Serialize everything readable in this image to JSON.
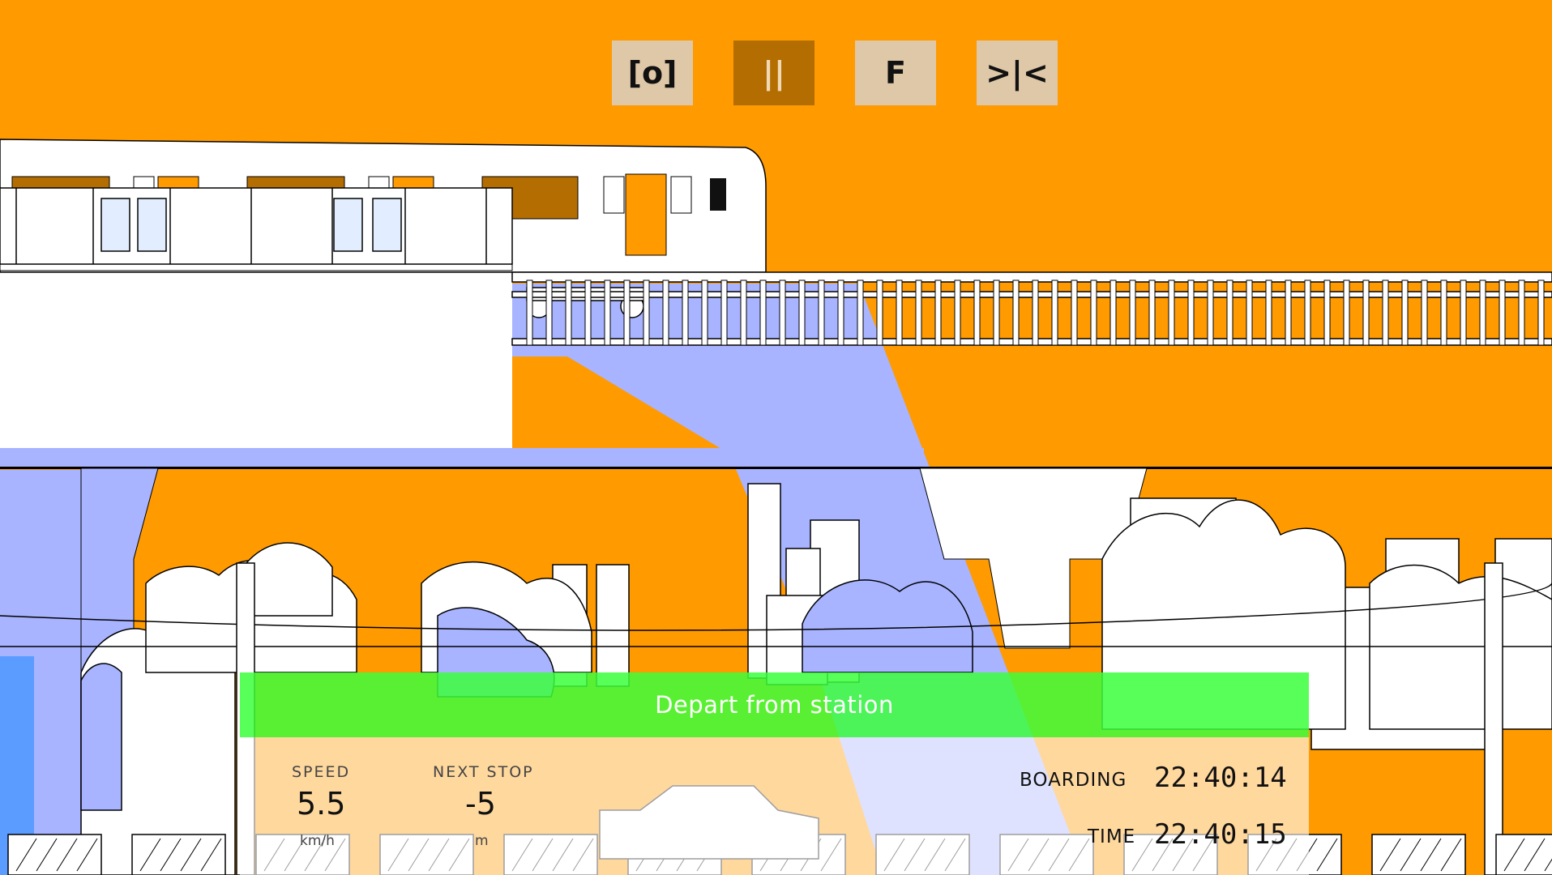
{
  "controls": {
    "camera_label": "[o]",
    "pause_label": "||",
    "forward_label": "F",
    "couple_label": ">|<"
  },
  "action": {
    "label": "Depart from station"
  },
  "hud": {
    "speed_label": "SPEED",
    "speed_value": "5.5",
    "speed_unit": "km/h",
    "next_stop_label": "NEXT STOP",
    "next_stop_value": "-5",
    "next_stop_unit": "m",
    "boarding_label": "BOARDING",
    "boarding_time": "22:40:14",
    "time_label": "TIME",
    "time_value": "22:40:15"
  },
  "colors": {
    "sky": "#ff9a00",
    "shadow": "#a8b4ff",
    "train_window": "#b36d00",
    "action_bar": "#3cff3c",
    "button_light": "#dfc8a8",
    "button_active": "#b36d00"
  }
}
